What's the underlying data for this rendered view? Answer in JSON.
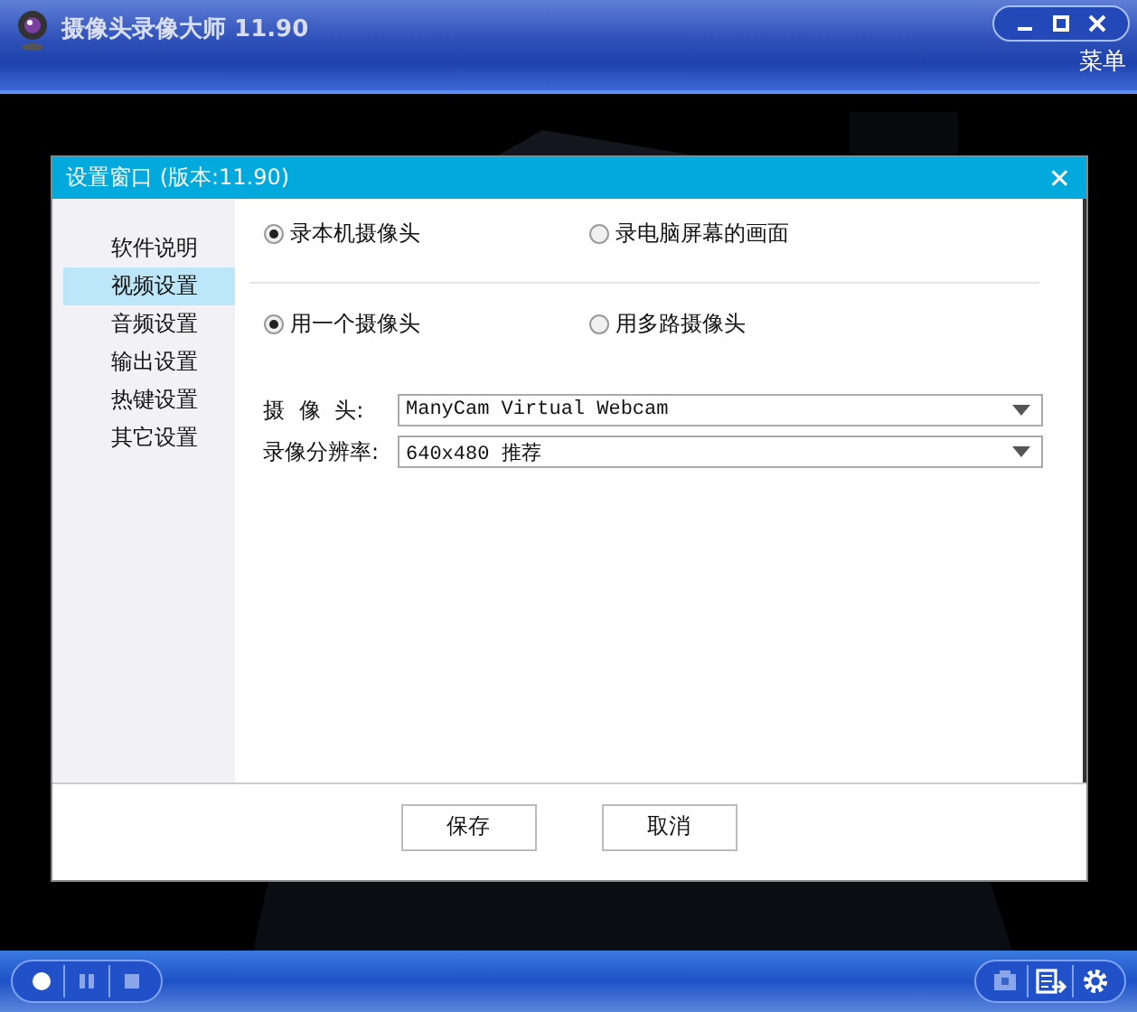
{
  "app": {
    "title": "摄像头录像大师 11.90",
    "menu": "菜单"
  },
  "dialog": {
    "title": "设置窗口 (版本:11.90)",
    "close": "✕",
    "sidebar": {
      "items": [
        {
          "label": "软件说明",
          "selected": false
        },
        {
          "label": "视频设置",
          "selected": true
        },
        {
          "label": "音频设置",
          "selected": false
        },
        {
          "label": "输出设置",
          "selected": false
        },
        {
          "label": "热键设置",
          "selected": false
        },
        {
          "label": "其它设置",
          "selected": false
        }
      ]
    },
    "source_options": [
      {
        "label": "录本机摄像头",
        "selected": true
      },
      {
        "label": "录电脑屏幕的画面",
        "selected": false
      }
    ],
    "camera_count_options": [
      {
        "label": "用一个摄像头",
        "selected": true
      },
      {
        "label": "用多路摄像头",
        "selected": false
      }
    ],
    "fields": [
      {
        "label": "摄 像 头:",
        "value": "ManyCam Virtual Webcam"
      },
      {
        "label": "录像分辨率:",
        "value": "640x480 推荐"
      }
    ],
    "buttons": [
      "保存",
      "取消"
    ]
  }
}
